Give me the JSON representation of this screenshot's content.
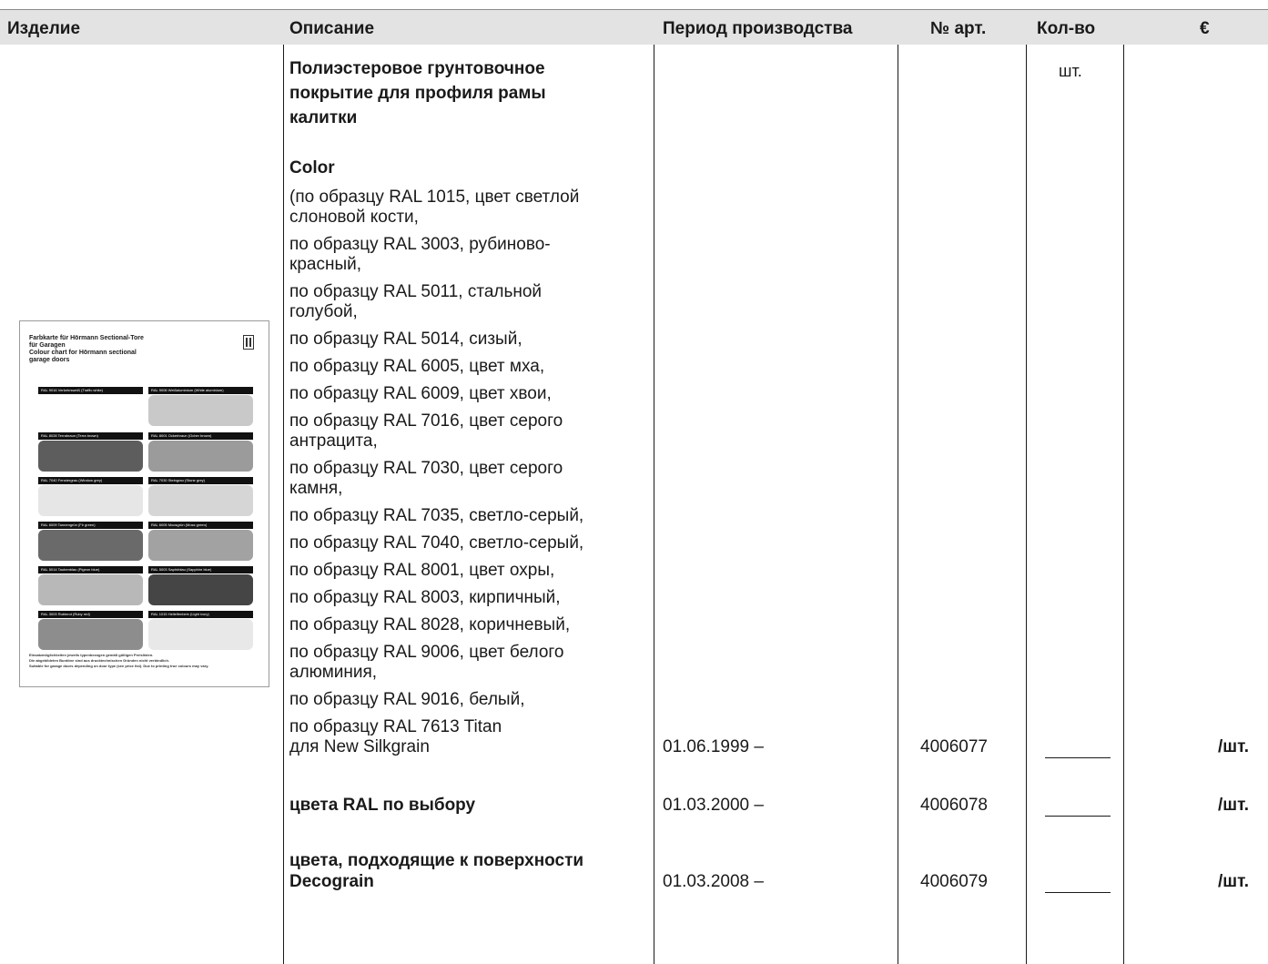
{
  "header": {
    "product": "Изделие",
    "description": "Описание",
    "period": "Период производства",
    "art": "№ арт.",
    "qty": "Кол-во",
    "price": "€"
  },
  "unit_header": "шт.",
  "title_lines": [
    "Полиэстеровое грунтовочное",
    "покрытие для профиля рамы",
    "калитки"
  ],
  "color_heading": "Color",
  "color_lines": [
    "(по образцу RAL 1015, цвет светлой",
    "слоновой кости,",
    "по образцу RAL 3003, рубиново-",
    "красный,",
    "по образцу RAL 5011, стальной",
    "голубой,",
    "по образцу RAL 5014, сизый,",
    "по образцу RAL 6005, цвет мха,",
    "по образцу RAL 6009, цвет хвои,",
    "по образцу RAL 7016, цвет серого",
    "антрацита,",
    "по образцу RAL 7030, цвет серого",
    "камня,",
    "по образцу RAL 7035, светло-серый,",
    "по образцу RAL 7040, светло-серый,",
    "по образцу RAL 8001, цвет охры,",
    "по образцу RAL 8003, кирпичный,",
    "по образцу RAL 8028, коричневый,",
    "по образцу RAL 9006, цвет белого",
    "алюминия,",
    "по образцу RAL 9016, белый,",
    "по образцу RAL 7613 Titan",
    "для New Silkgrain"
  ],
  "rows": [
    {
      "period": "01.06.1999 –",
      "art": "4006077",
      "price": "/шт."
    },
    {
      "label": "цвета RAL по выбору",
      "period": "01.03.2000 –",
      "art": "4006078",
      "price": "/шт."
    },
    {
      "label_lines": [
        "цвета, подходящие к поверхности",
        "Decograin"
      ],
      "period": "01.03.2008 –",
      "art": "4006079",
      "price": "/шт."
    }
  ],
  "card": {
    "title_lines": [
      "Farbkarte für Hörmann Sectional-Tore",
      "für Garagen",
      "Colour chart for Hörmann sectional",
      "garage doors"
    ],
    "swatches": [
      {
        "label": "RAL 9016 Verkehrsweiß (Traffic white)",
        "color": "#ffffff"
      },
      {
        "label": "RAL 9006 Weißaluminium (White aluminium)",
        "color": "#c9c9c9"
      },
      {
        "label": "RAL 8028 Terrabraun (Terra brown)",
        "color": "#5d5d5d"
      },
      {
        "label": "RAL 8001 Ockerbraun (Ocher brown)",
        "color": "#9b9b9b"
      },
      {
        "label": "RAL 7040 Fenstergrau (Window grey)",
        "color": "#e6e6e6"
      },
      {
        "label": "RAL 7030 Steingrau (Stone grey)",
        "color": "#d6d6d6"
      },
      {
        "label": "RAL 6009 Tannengrün (Fir green)",
        "color": "#6a6a6a"
      },
      {
        "label": "RAL 6005 Moosgrün (Moss green)",
        "color": "#a2a2a2"
      },
      {
        "label": "RAL 5014 Taubenblau (Pigeon blue)",
        "color": "#b8b8b8"
      },
      {
        "label": "RAL 5003 Saphirblau (Sapphire blue)",
        "color": "#454545"
      },
      {
        "label": "RAL 3003 Rubinrot (Ruby red)",
        "color": "#8d8d8d"
      },
      {
        "label": "RAL 1015 Hellelfenbein (Light ivory)",
        "color": "#e8e8e8"
      }
    ],
    "footer_lines": [
      "Einsatzmöglichkeiten jeweils typenbezogen gemäß gültigen Preislisten.",
      "Die abgebildeten Buntöne sind aus drucktechnischen Gründen nicht verbindlich.",
      "Suitable for garage doors depending on door type (see price list). Due to printing true colours may vary."
    ]
  },
  "colors": {
    "header_bg": "#e3e3e3",
    "text": "#1a1a1a"
  }
}
